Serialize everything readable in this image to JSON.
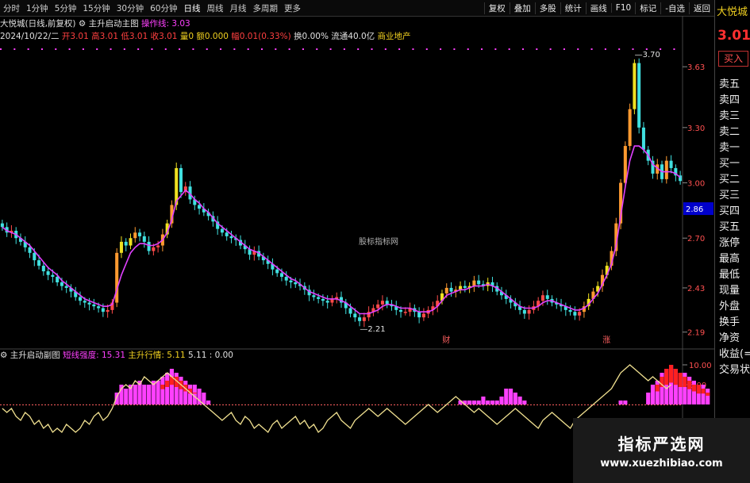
{
  "toolbar": {
    "periods": [
      "分时",
      "1分钟",
      "5分钟",
      "15分钟",
      "30分钟",
      "60分钟",
      "日线",
      "周线",
      "月线",
      "多周期",
      "更多"
    ],
    "tools": [
      "复权",
      "叠加",
      "多股",
      "统计",
      "画线",
      "F10",
      "标记",
      "-自选",
      "返回"
    ]
  },
  "info_line1": {
    "stock": "大悦城(日线,前复权)",
    "indicator_name": "主升启动主图",
    "line_label": "操作线: 3.03"
  },
  "info_line2": {
    "date": "2024/10/22/二",
    "open": "开3.01",
    "high": "高3.01",
    "low": "低3.01",
    "close": "收3.01",
    "vol": "量0",
    "amt": "额0.000",
    "chg": "幅0.01(0.33%)",
    "turn": "换0.00%",
    "float": "流通40.0亿",
    "sector": "商业地产"
  },
  "right_panel": {
    "name": "大悦城",
    "price": "3.01",
    "sell_btn": "买入",
    "rows": [
      "卖五",
      "卖四",
      "卖三",
      "卖二",
      "卖一",
      "买一",
      "买二",
      "买三",
      "买四",
      "买五",
      "涨停",
      "最高",
      "最低",
      "现量",
      "外盘",
      "换手",
      "净资",
      "收益(=)",
      "交易状"
    ]
  },
  "sub_info": {
    "name": "主升启动副图",
    "s1": "短线强度: 15.31",
    "s2": "主升行情: 5.11",
    "s3": "5.11 : 0.00"
  },
  "center_watermark": "股标指标网",
  "watermark": {
    "title": "指标严选网",
    "url": "www.xuezhibiao.com"
  },
  "colors": {
    "up": "#ff4a4a",
    "down": "#40e0e0",
    "ma": "#e040ff",
    "yellow": "#f0e020",
    "orange": "#ff9a30",
    "magenta": "#ff40ff",
    "red": "#ff2020",
    "line": "#f0e090"
  },
  "chart_data": [
    {
      "type": "candlestick",
      "price_axis_ticks": [
        "3.63",
        "3.30",
        "3.00",
        "2.70",
        "2.43",
        "2.19"
      ],
      "ylim": [
        2.12,
        3.82
      ],
      "annotations": [
        "3.70",
        "2.21",
        "财",
        "涨"
      ],
      "current_price_label": "2.86",
      "closes": [
        2.76,
        2.73,
        2.74,
        2.7,
        2.68,
        2.65,
        2.62,
        2.58,
        2.55,
        2.52,
        2.5,
        2.49,
        2.46,
        2.44,
        2.43,
        2.41,
        2.38,
        2.36,
        2.35,
        2.34,
        2.33,
        2.32,
        2.3,
        2.31,
        2.35,
        2.62,
        2.68,
        2.66,
        2.7,
        2.73,
        2.71,
        2.68,
        2.63,
        2.65,
        2.66,
        2.72,
        2.78,
        2.88,
        3.08,
        2.95,
        2.98,
        2.91,
        2.88,
        2.86,
        2.84,
        2.82,
        2.79,
        2.75,
        2.73,
        2.71,
        2.7,
        2.69,
        2.66,
        2.64,
        2.61,
        2.63,
        2.6,
        2.58,
        2.56,
        2.53,
        2.51,
        2.49,
        2.47,
        2.46,
        2.45,
        2.44,
        2.42,
        2.39,
        2.38,
        2.37,
        2.36,
        2.35,
        2.37,
        2.38,
        2.35,
        2.32,
        2.29,
        2.27,
        2.25,
        2.27,
        2.3,
        2.32,
        2.34,
        2.36,
        2.34,
        2.33,
        2.31,
        2.3,
        2.3,
        2.32,
        2.3,
        2.27,
        2.29,
        2.31,
        2.33,
        2.36,
        2.4,
        2.43,
        2.41,
        2.42,
        2.44,
        2.43,
        2.44,
        2.47,
        2.45,
        2.44,
        2.46,
        2.44,
        2.41,
        2.39,
        2.37,
        2.35,
        2.33,
        2.31,
        2.29,
        2.31,
        2.33,
        2.36,
        2.39,
        2.37,
        2.35,
        2.34,
        2.33,
        2.31,
        2.3,
        2.28,
        2.3,
        2.33,
        2.37,
        2.41,
        2.44,
        2.5,
        2.55,
        2.63,
        2.78,
        3.0,
        3.2,
        3.4,
        3.65,
        3.3,
        3.18,
        3.12,
        3.05,
        3.1,
        3.02,
        3.12,
        3.08,
        3.04,
        3.01
      ],
      "ma_line": [
        2.76,
        2.74,
        2.73,
        2.72,
        2.7,
        2.68,
        2.66,
        2.63,
        2.6,
        2.57,
        2.54,
        2.52,
        2.5,
        2.47,
        2.45,
        2.43,
        2.41,
        2.39,
        2.37,
        2.36,
        2.35,
        2.34,
        2.33,
        2.33,
        2.34,
        2.42,
        2.5,
        2.56,
        2.62,
        2.65,
        2.67,
        2.67,
        2.66,
        2.66,
        2.67,
        2.69,
        2.73,
        2.8,
        2.9,
        2.93,
        2.96,
        2.94,
        2.91,
        2.89,
        2.86,
        2.84,
        2.81,
        2.78,
        2.76,
        2.74,
        2.72,
        2.7,
        2.68,
        2.66,
        2.64,
        2.63,
        2.62,
        2.6,
        2.58,
        2.56,
        2.54,
        2.52,
        2.5,
        2.48,
        2.47,
        2.45,
        2.43,
        2.41,
        2.4,
        2.39,
        2.38,
        2.37,
        2.37,
        2.37,
        2.36,
        2.35,
        2.33,
        2.31,
        2.29,
        2.29,
        2.29,
        2.3,
        2.31,
        2.33,
        2.34,
        2.34,
        2.33,
        2.32,
        2.32,
        2.32,
        2.31,
        2.3,
        2.3,
        2.3,
        2.31,
        2.33,
        2.36,
        2.39,
        2.4,
        2.41,
        2.42,
        2.42,
        2.43,
        2.44,
        2.44,
        2.44,
        2.45,
        2.44,
        2.43,
        2.41,
        2.39,
        2.37,
        2.35,
        2.33,
        2.32,
        2.32,
        2.32,
        2.33,
        2.35,
        2.36,
        2.36,
        2.35,
        2.34,
        2.33,
        2.32,
        2.31,
        2.31,
        2.32,
        2.34,
        2.37,
        2.4,
        2.45,
        2.5,
        2.56,
        2.66,
        2.82,
        2.98,
        3.12,
        3.2,
        3.2,
        3.18,
        3.15,
        3.1,
        3.08,
        3.06,
        3.06,
        3.06,
        3.05,
        3.03
      ]
    },
    {
      "type": "histogram+line",
      "axis_ticks": [
        "10.00",
        "5.00"
      ],
      "ylim": [
        -8,
        12
      ],
      "indicator_values": [
        0,
        0,
        0,
        0,
        0,
        0,
        0,
        0,
        0,
        0,
        0,
        0,
        0,
        0,
        0,
        0,
        0,
        0,
        0,
        0,
        0,
        0,
        0,
        0,
        0,
        3,
        5,
        4,
        5,
        5,
        6,
        5,
        5,
        6,
        6,
        7,
        8,
        9,
        8,
        7,
        6,
        5,
        5,
        4,
        3,
        1,
        0,
        0,
        0,
        0,
        0,
        0,
        0,
        0,
        0,
        0,
        0,
        0,
        0,
        0,
        0,
        0,
        0,
        0,
        0,
        0,
        0,
        0,
        0,
        0,
        0,
        0,
        0,
        0,
        0,
        0,
        0,
        0,
        0,
        0,
        0,
        0,
        0,
        0,
        0,
        0,
        0,
        0,
        0,
        0,
        0,
        0,
        0,
        0,
        0,
        0,
        0,
        0,
        0,
        0,
        1,
        1,
        1,
        1,
        1,
        2,
        1,
        1,
        1,
        2,
        4,
        4,
        3,
        2,
        1,
        0,
        0,
        0,
        0,
        0,
        0,
        0,
        0,
        0,
        0,
        0,
        0,
        0,
        0,
        0,
        0,
        0,
        0,
        0,
        0,
        1,
        1,
        0,
        0,
        0,
        0,
        3,
        5,
        6,
        8,
        9,
        10,
        9,
        8,
        8,
        7,
        6,
        5,
        5,
        4
      ],
      "main_values": [
        0,
        0,
        0,
        0,
        0,
        0,
        0,
        0,
        0,
        0,
        0,
        0,
        0,
        0,
        0,
        0,
        0,
        0,
        0,
        0,
        0,
        0,
        0,
        0,
        0,
        0,
        0,
        0,
        0,
        0,
        0,
        0,
        0,
        0,
        0,
        5,
        6,
        7,
        7,
        6,
        5,
        4,
        3,
        0,
        0,
        0,
        0,
        0,
        0,
        0,
        0,
        0,
        0,
        0,
        0,
        0,
        0,
        0,
        0,
        0,
        0,
        0,
        0,
        0,
        0,
        0,
        0,
        0,
        0,
        0,
        0,
        0,
        0,
        0,
        0,
        0,
        0,
        0,
        0,
        0,
        0,
        0,
        0,
        0,
        0,
        0,
        0,
        0,
        0,
        0,
        0,
        0,
        0,
        0,
        0,
        0,
        0,
        0,
        0,
        0,
        0,
        0,
        0,
        0,
        0,
        0,
        0,
        0,
        0,
        0,
        0,
        0,
        0,
        0,
        0,
        0,
        0,
        0,
        0,
        0,
        0,
        0,
        0,
        0,
        0,
        0,
        0,
        0,
        0,
        0,
        0,
        0,
        0,
        0,
        0,
        0,
        0,
        0,
        0,
        0,
        0,
        0,
        0,
        5,
        7,
        9,
        10,
        9,
        8,
        7,
        6,
        5,
        5,
        4,
        3
      ],
      "line_values": [
        -1,
        -2,
        -1,
        -3,
        -4,
        -2,
        -3,
        -5,
        -4,
        -6,
        -5,
        -7,
        -6,
        -7,
        -5,
        -6,
        -7,
        -6,
        -4,
        -5,
        -3,
        -2,
        -4,
        -3,
        -1,
        2,
        4,
        5,
        4,
        6,
        5,
        7,
        6,
        5,
        6,
        7,
        8,
        7,
        6,
        5,
        4,
        3,
        2,
        1,
        0,
        -1,
        -2,
        -3,
        -4,
        -3,
        -2,
        -4,
        -5,
        -3,
        -4,
        -6,
        -5,
        -6,
        -7,
        -5,
        -4,
        -6,
        -5,
        -4,
        -3,
        -5,
        -4,
        -6,
        -5,
        -7,
        -6,
        -4,
        -3,
        -2,
        -4,
        -5,
        -6,
        -4,
        -3,
        -2,
        -1,
        -2,
        -3,
        -2,
        -1,
        -2,
        -3,
        -4,
        -5,
        -4,
        -3,
        -2,
        -1,
        0,
        -1,
        -2,
        -1,
        0,
        1,
        2,
        1,
        0,
        -1,
        -2,
        -1,
        -2,
        -3,
        -4,
        -5,
        -4,
        -3,
        -2,
        -1,
        -2,
        -3,
        -4,
        -5,
        -6,
        -4,
        -3,
        -2,
        -3,
        -4,
        -5,
        -6,
        -4,
        -3,
        -2,
        -1,
        0,
        1,
        2,
        3,
        4,
        6,
        8,
        9,
        10,
        9,
        8,
        7,
        6,
        7,
        6,
        5,
        4,
        5
      ]
    }
  ]
}
